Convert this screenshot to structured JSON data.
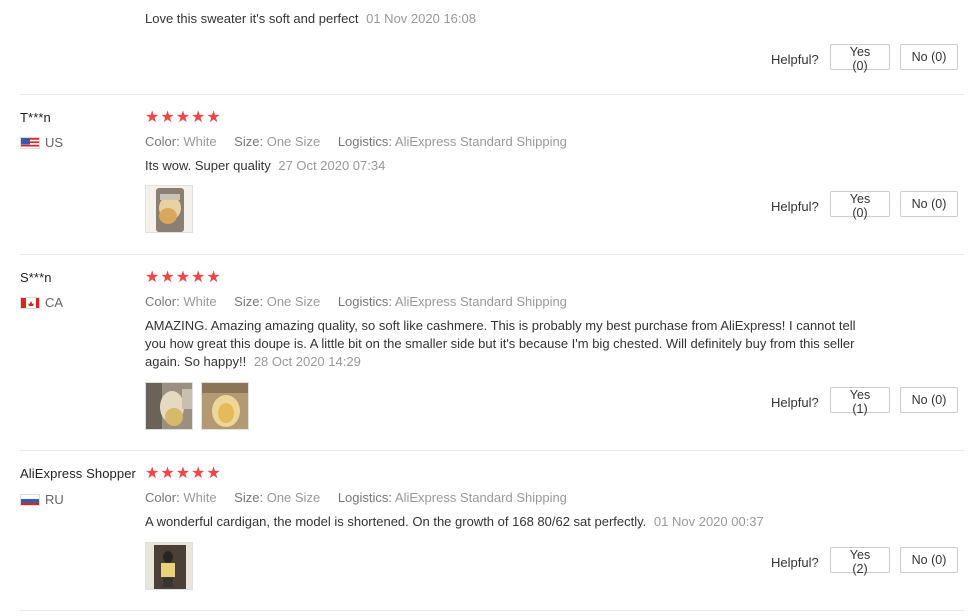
{
  "labels": {
    "color": "Color:",
    "size": "Size:",
    "logistics": "Logistics:",
    "helpful": "Helpful?"
  },
  "star_glyph": "★",
  "colors": {
    "star": "#f24646",
    "muted": "#999999"
  },
  "reviews": [
    {
      "user": "",
      "country": "",
      "text": "Love this sweater it's soft and perfect",
      "date": "01 Nov 2020 16:08",
      "yes": "Yes (0)",
      "no": "No (0)"
    },
    {
      "user": "T***n",
      "country": "US",
      "rating": 5,
      "color": "White",
      "size": "One Size",
      "logistics": "AliExpress Standard Shipping",
      "text": "Its wow. Super quality",
      "date": "27 Oct 2020 07:34",
      "yes": "Yes (0)",
      "no": "No (0)"
    },
    {
      "user": "S***n",
      "country": "CA",
      "rating": 5,
      "color": "White",
      "size": "One Size",
      "logistics": "AliExpress Standard Shipping",
      "text": "AMAZING. Amazing amazing quality, so soft like cashmere. This is probably my best purchase from AliExpress! I cannot tell you how great this doupe is. A little bit on the smaller side but it's because I'm big chested. Will definitely buy from this seller again. So happy!!",
      "date": "28 Oct 2020 14:29",
      "yes": "Yes (1)",
      "no": "No (0)"
    },
    {
      "user": "AliExpress Shopper",
      "country": "RU",
      "rating": 5,
      "color": "White",
      "size": "One Size",
      "logistics": "AliExpress Standard Shipping",
      "text": "A wonderful cardigan, the model is shortened. On the growth of 168 80/62 sat perfectly.",
      "date": "01 Nov 2020 00:37",
      "yes": "Yes (2)",
      "no": "No (0)"
    }
  ]
}
